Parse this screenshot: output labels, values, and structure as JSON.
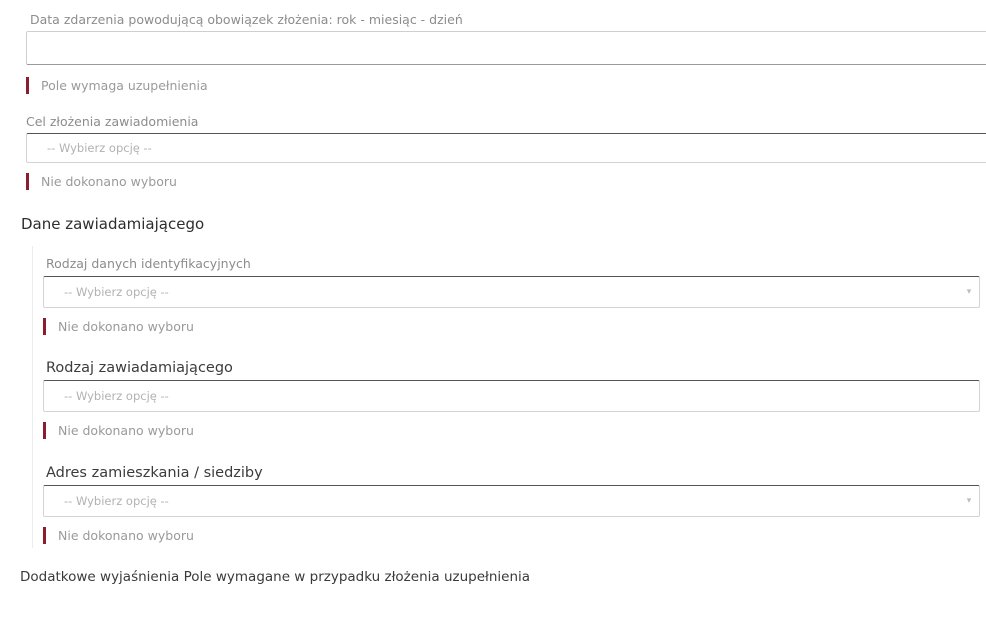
{
  "fields": {
    "event_date": {
      "label": "Data zdarzenia powodującą obowiązek złożenia: rok - miesiąc - dzień",
      "value": "",
      "error": "Pole wymaga uzupełnienia"
    },
    "purpose": {
      "label": "Cel złożenia zawiadomienia",
      "placeholder": "-- Wybierz opcję --",
      "error": "Nie dokonano wyboru"
    }
  },
  "section": {
    "title": "Dane zawiadamiającego"
  },
  "notifier": {
    "id_type": {
      "label": "Rodzaj danych identyfikacyjnych",
      "placeholder": "-- Wybierz opcję --",
      "error": "Nie dokonano wyboru"
    },
    "notifier_type": {
      "label": "Rodzaj zawiadamiającego",
      "placeholder": "-- Wybierz opcję --",
      "error": "Nie dokonano wyboru"
    },
    "address": {
      "label": "Adres zamieszkania / siedziby",
      "placeholder": "-- Wybierz opcję --",
      "error": "Nie dokonano wyboru"
    }
  },
  "footer": {
    "additional": "Dodatkowe wyjaśnienia  Pole wymagane w przypadku złożenia uzupełnienia"
  },
  "icons": {
    "dropdown": "chevron-down-icon"
  },
  "colors": {
    "error_bar": "#8c1d2e"
  }
}
